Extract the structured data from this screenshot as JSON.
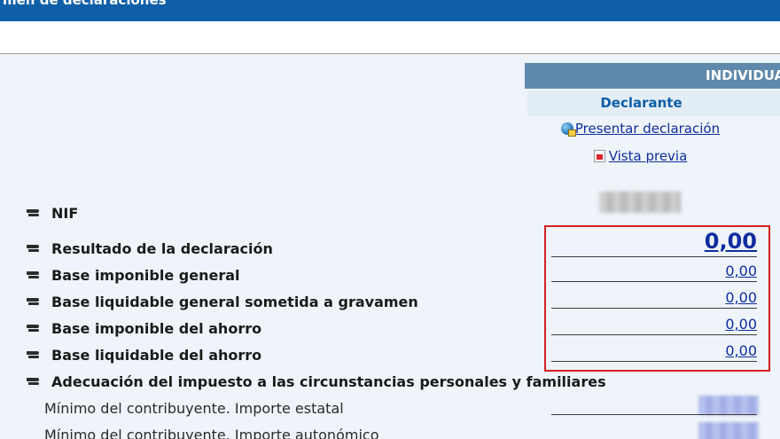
{
  "header": {
    "title": "men de declaraciones"
  },
  "table": {
    "column_group": "INDIVIDUAL",
    "column": "Declarante",
    "links": {
      "present": "Presentar declaración",
      "preview": "Vista previa"
    }
  },
  "rows": {
    "nif": {
      "label": "NIF"
    },
    "resultado": {
      "label": "Resultado de la declaración",
      "value": "0,00"
    },
    "base_imponible_general": {
      "label": "Base imponible general",
      "value": "0,00"
    },
    "base_liquidable_general": {
      "label": "Base liquidable general sometida a gravamen",
      "value": "0,00"
    },
    "base_imponible_ahorro": {
      "label": "Base imponible del ahorro",
      "value": "0,00"
    },
    "base_liquidable_ahorro": {
      "label": "Base liquidable del ahorro",
      "value": "0,00"
    },
    "adecuacion": {
      "label": "Adecuación del impuesto a las circunstancias personales y familiares"
    },
    "minimo_estatal": {
      "label": "Mínimo del contribuyente. Importe estatal"
    },
    "minimo_autonomico": {
      "label": "Mínimo del contribuyente. Importe autonómico"
    }
  }
}
